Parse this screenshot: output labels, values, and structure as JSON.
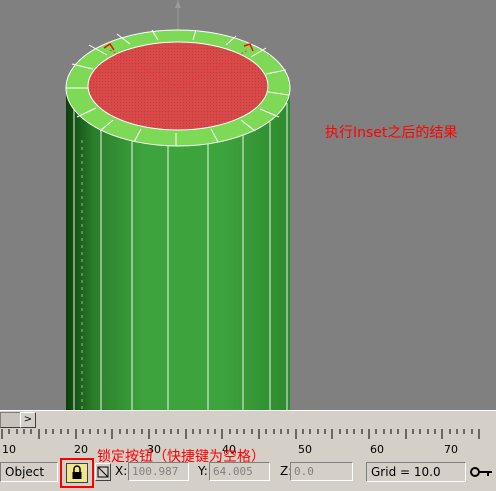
{
  "annotations": {
    "result_note": "执行Inset之后的结果",
    "lock_note": "锁定按钮（快捷键为空格）"
  },
  "timeline": {
    "arrow_label": ">",
    "ticks": [
      "10",
      "20",
      "30",
      "40",
      "50",
      "60",
      "70"
    ]
  },
  "status": {
    "selection_label": "Object",
    "x_label": "X:",
    "x_value": "100.987",
    "y_label": "Y:",
    "y_value": "64.005",
    "z_label": "Z:",
    "z_value": "0.0",
    "grid_label": "Grid = 10.0"
  },
  "colors": {
    "viewport_bg": "#808080",
    "cylinder_green": "#3da33d",
    "cap_red": "#d84a4a",
    "rim_green": "#7ed957",
    "annotation_red": "#ff0000"
  },
  "icons": {
    "lock": "lock-icon",
    "selection_mode": "selection-mode-icon",
    "key": "key-icon"
  }
}
